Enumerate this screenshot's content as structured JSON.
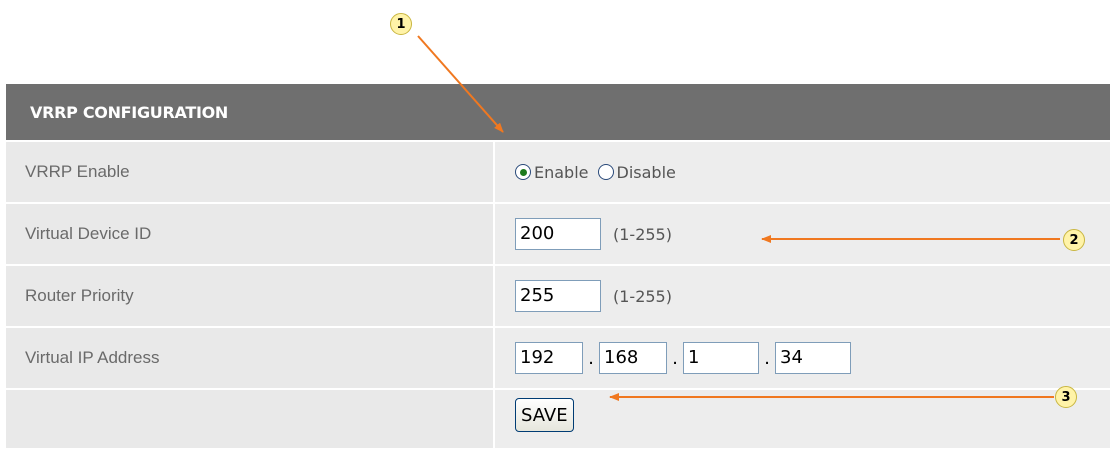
{
  "header": {
    "title": "VRRP CONFIGURATION"
  },
  "rows": {
    "vrrp_enable": {
      "label": "VRRP Enable",
      "options": [
        "Enable",
        "Disable"
      ],
      "selected": "Enable"
    },
    "virtual_device_id": {
      "label": "Virtual Device ID",
      "value": "200",
      "hint": "(1-255)"
    },
    "router_priority": {
      "label": "Router Priority",
      "value": "255",
      "hint": "(1-255)"
    },
    "virtual_ip": {
      "label": "Virtual IP Address",
      "octets": [
        "192",
        "168",
        "1",
        "34"
      ],
      "separator": "."
    }
  },
  "save_label": "SAVE",
  "callouts": [
    "1",
    "2",
    "3"
  ],
  "colors": {
    "header_bg": "#6f6f6f",
    "label_bg": "#e9e9e9",
    "value_bg": "#ededed",
    "arrow": "#f07820",
    "callout_fill": "#fff3a8"
  },
  "icons": {
    "radio_selected": "radio-selected-icon",
    "radio_unselected": "radio-unselected-icon"
  }
}
